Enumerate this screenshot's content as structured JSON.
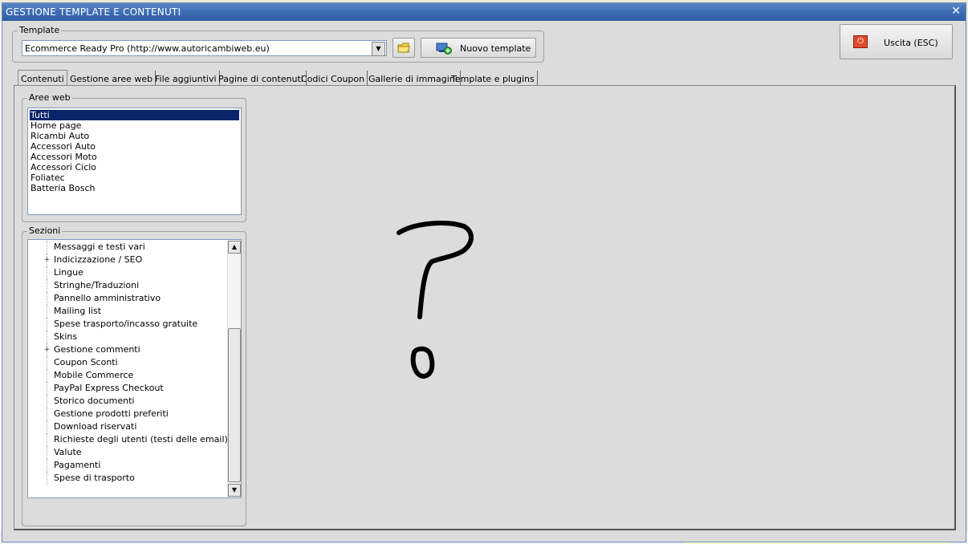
{
  "window": {
    "title": "GESTIONE TEMPLATE E CONTENUTI"
  },
  "template_group": {
    "legend": "Template",
    "selected": "Ecommerce Ready Pro (http://www.autoricambiweb.eu)",
    "new_button": "Nuovo template"
  },
  "exit_button": "Uscita (ESC)",
  "tabs": [
    "Contenuti",
    "Gestione aree web",
    "File aggiuntivi",
    "Pagine di contenuti",
    "Codici Coupon",
    "Gallerie di immagini",
    "Template e plugins"
  ],
  "aree_web": {
    "legend": "Aree web",
    "items": [
      "Tutti",
      "Home page",
      "Ricambi Auto",
      "Accessori Auto",
      "Accessori Moto",
      "Accessori Ciclo",
      "Foliatec",
      "Batteria Bosch"
    ]
  },
  "sezioni": {
    "legend": "Sezioni",
    "items": [
      {
        "label": "Messaggi e testi vari",
        "expandable": false
      },
      {
        "label": "Indicizzazione / SEO",
        "expandable": true
      },
      {
        "label": "Lingue",
        "expandable": false
      },
      {
        "label": "Stringhe/Traduzioni",
        "expandable": false
      },
      {
        "label": "Pannello amministrativo",
        "expandable": false
      },
      {
        "label": "Mailing list",
        "expandable": false
      },
      {
        "label": "Spese trasporto/incasso gratuite",
        "expandable": false
      },
      {
        "label": "Skins",
        "expandable": false
      },
      {
        "label": "Gestione commenti",
        "expandable": true
      },
      {
        "label": "Coupon Sconti",
        "expandable": false
      },
      {
        "label": "Mobile Commerce",
        "expandable": false
      },
      {
        "label": "PayPal Express Checkout",
        "expandable": false
      },
      {
        "label": "Storico documenti",
        "expandable": false
      },
      {
        "label": "Gestione prodotti preferiti",
        "expandable": false
      },
      {
        "label": "Download riservati",
        "expandable": false
      },
      {
        "label": "Richieste degli utenti (testi delle email)",
        "expandable": false
      },
      {
        "label": "Valute",
        "expandable": false
      },
      {
        "label": "Pagamenti",
        "expandable": false
      },
      {
        "label": "Spese di trasporto",
        "expandable": false
      }
    ]
  },
  "annotation": {
    "icon": "question-mark-drawing"
  },
  "colors": {
    "title_bar": "#3d6db3",
    "selection": "#0a246a",
    "window_bg": "#dcdcdc"
  }
}
